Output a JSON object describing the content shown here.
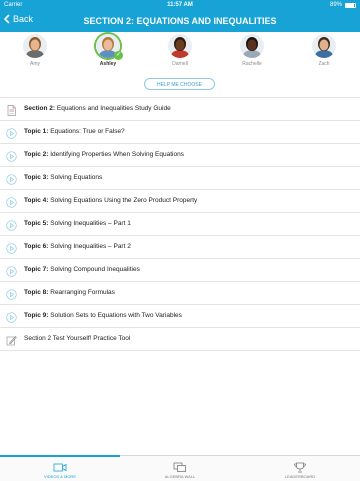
{
  "statusbar": {
    "carrier": "Carrier",
    "time": "11:57 AM",
    "battery": "89%",
    "battery_level": 0.89
  },
  "navbar": {
    "back_label": "Back",
    "title": "SECTION 2: EQUATIONS AND INEQUALITIES"
  },
  "people": [
    {
      "name": "Amy",
      "selected": false,
      "skin": "#e7b58f",
      "hair": "#8a5a2b",
      "shirt": "#6b6b6b"
    },
    {
      "name": "Ashley",
      "selected": true,
      "skin": "#e9bb98",
      "hair": "#b07a3a",
      "shirt": "#5e8fc2"
    },
    {
      "name": "Darnell",
      "selected": false,
      "skin": "#6b3e22",
      "hair": "#2a1a10",
      "shirt": "#c0392b"
    },
    {
      "name": "Rachelle",
      "selected": false,
      "skin": "#5a3320",
      "hair": "#1f140c",
      "shirt": "#9aa9b8"
    },
    {
      "name": "Zach",
      "selected": false,
      "skin": "#e3b08c",
      "hair": "#3a2a1c",
      "shirt": "#3d6fa3"
    }
  ],
  "help_button": "HELP ME CHOOSE",
  "items": [
    {
      "icon": "document-icon",
      "bold": "Section 2:",
      "text": " Equations and Inequalities Study Guide"
    },
    {
      "icon": "play-icon",
      "bold": "Topic 1:",
      "text": " Equations: True or False?"
    },
    {
      "icon": "play-icon",
      "bold": "Topic 2:",
      "text": " Identifying Properties When Solving Equations"
    },
    {
      "icon": "play-icon",
      "bold": "Topic 3:",
      "text": " Solving Equations"
    },
    {
      "icon": "play-icon",
      "bold": "Topic 4:",
      "text": " Solving Equations Using the Zero Product Property"
    },
    {
      "icon": "play-icon",
      "bold": "Topic 5:",
      "text": " Solving Inequalities – Part 1"
    },
    {
      "icon": "play-icon",
      "bold": "Topic 6:",
      "text": " Solving Inequalities – Part 2"
    },
    {
      "icon": "play-icon",
      "bold": "Topic 7:",
      "text": " Solving Compound Inequalities"
    },
    {
      "icon": "play-icon",
      "bold": "Topic 8:",
      "text": " Rearranging Formulas"
    },
    {
      "icon": "play-icon",
      "bold": "Topic 9:",
      "text": " Solution Sets to Equations with Two Variables"
    },
    {
      "icon": "pencil-icon",
      "bold": "",
      "text": "Section 2 Test Yourself! Practice Tool"
    }
  ],
  "tabs": [
    {
      "label": "VIDEOS & MORE",
      "icon": "video-icon",
      "active": true
    },
    {
      "label": "ALGEBRA WALL",
      "icon": "chat-icon",
      "active": false
    },
    {
      "label": "LEADERBOARD",
      "icon": "trophy-icon",
      "active": false
    }
  ],
  "colors": {
    "accent": "#17a3d5",
    "check": "#6cc04a"
  }
}
